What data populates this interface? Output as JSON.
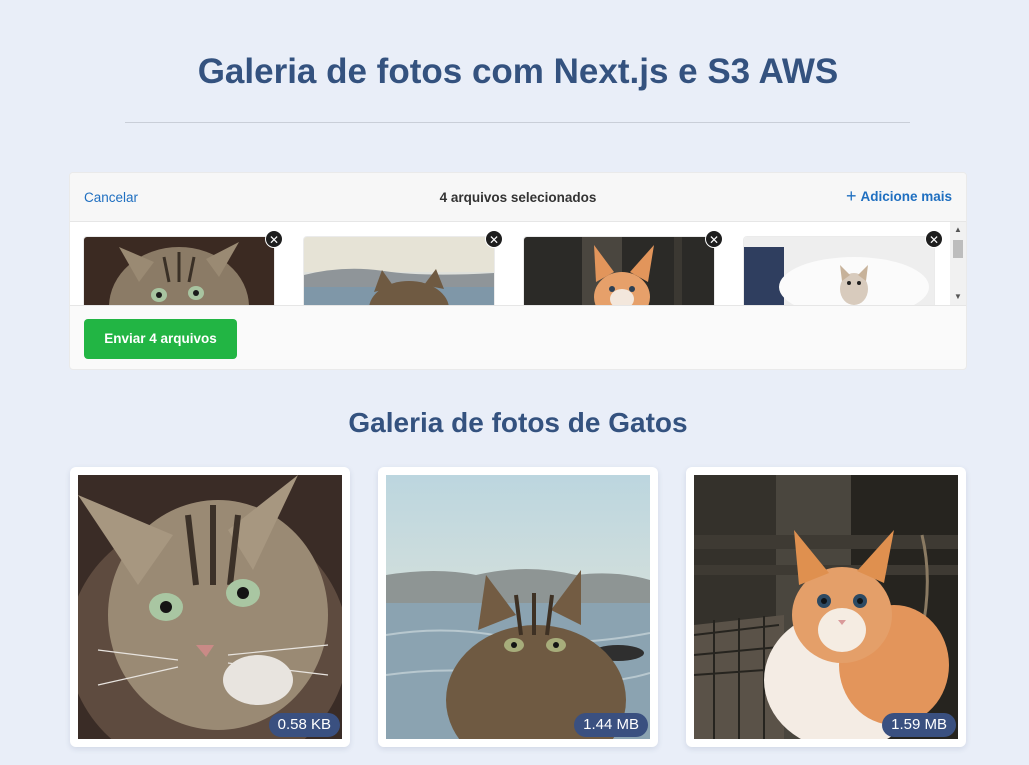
{
  "header": {
    "title": "Galeria de fotos com Next.js e S3 AWS"
  },
  "uploader": {
    "cancel_label": "Cancelar",
    "selected_text": "4 arquivos selecionados",
    "add_more_label": "Adicione mais",
    "add_more_icon": "plus-icon",
    "send_label": "Enviar 4 arquivos",
    "send_color": "#22b544",
    "remove_icon": "close-icon",
    "files": [
      {
        "name": "cat-tabby-closeup"
      },
      {
        "name": "cat-seaside"
      },
      {
        "name": "kitten-orange"
      },
      {
        "name": "kitten-pillow"
      }
    ]
  },
  "gallery": {
    "title": "Galeria de fotos de Gatos",
    "photos": [
      {
        "size": "0.58 KB"
      },
      {
        "size": "1.44 MB"
      },
      {
        "size": "1.59 MB"
      }
    ]
  },
  "colors": {
    "page_bg": "#e9eef8",
    "title": "#34527f",
    "badge": "#3a5080",
    "link": "#1f6fc0"
  }
}
